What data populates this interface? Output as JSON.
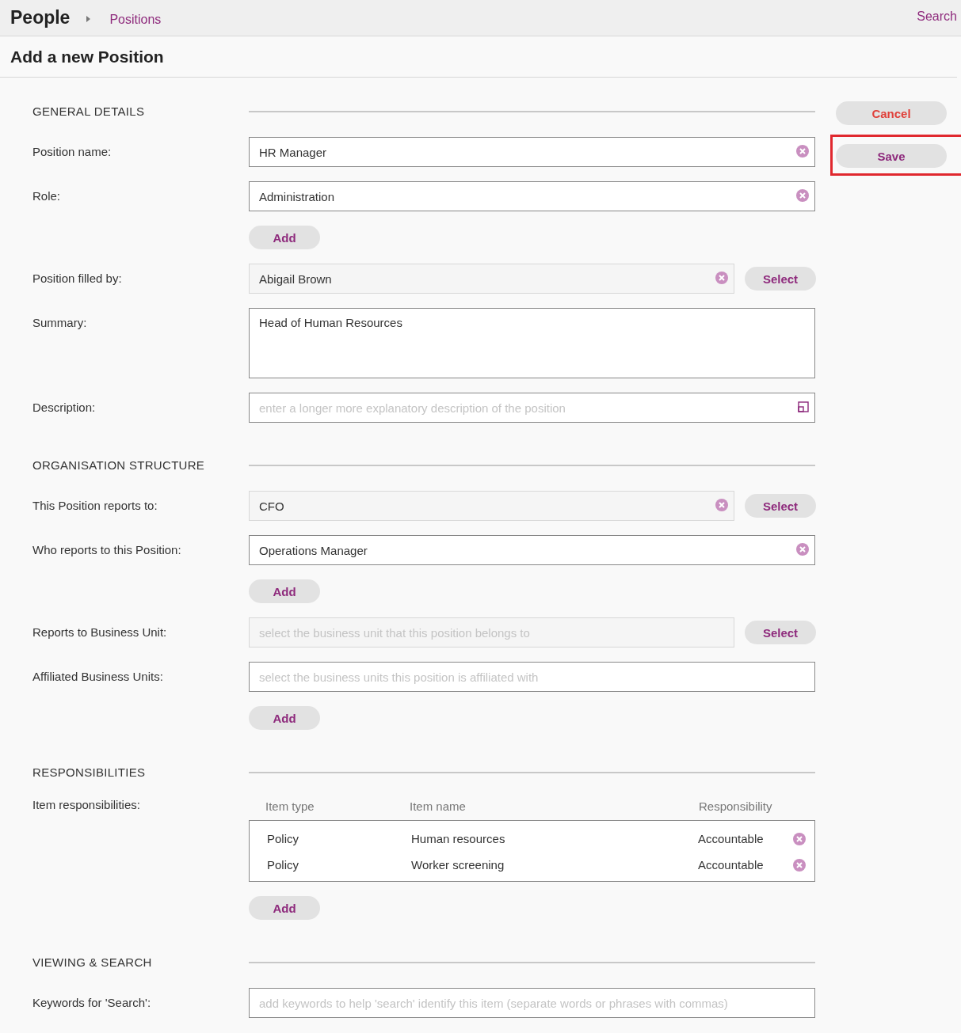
{
  "breadcrumb": {
    "title": "People",
    "current": "Positions"
  },
  "search_link": "Search",
  "page_title": "Add a new Position",
  "actions": [
    {
      "label": "Cancel",
      "kind": "cancel",
      "highlighted": false
    },
    {
      "label": "Save",
      "kind": "save",
      "highlighted": true
    }
  ],
  "sections": [
    {
      "title": "GENERAL DETAILS",
      "rows": [
        {
          "kind": "input",
          "label": "Position name:",
          "value": "HR Manager",
          "clearable": true
        },
        {
          "kind": "input",
          "label": "Role:",
          "value": "Administration",
          "clearable": true
        },
        {
          "kind": "add",
          "button": "Add"
        },
        {
          "kind": "picker",
          "label": "Position filled by:",
          "value": "Abigail Brown",
          "clearable": true,
          "button": "Select"
        },
        {
          "kind": "textarea",
          "label": "Summary:",
          "value": "Head of Human Resources"
        },
        {
          "kind": "input",
          "label": "Description:",
          "placeholder": "enter a longer more explanatory description of the position",
          "expandable": true
        }
      ]
    },
    {
      "title": "ORGANISATION STRUCTURE",
      "rows": [
        {
          "kind": "picker",
          "label": "This Position reports to:",
          "value": "CFO",
          "clearable": true,
          "button": "Select"
        },
        {
          "kind": "input",
          "label": "Who reports to this Position:",
          "value": "Operations Manager",
          "clearable": true
        },
        {
          "kind": "add",
          "button": "Add"
        },
        {
          "kind": "picker",
          "label": "Reports to Business Unit:",
          "placeholder": "select the business unit that this position belongs to",
          "button": "Select"
        },
        {
          "kind": "input",
          "label": "Affiliated Business Units:",
          "placeholder": "select the business units this position is affiliated with"
        },
        {
          "kind": "add",
          "button": "Add"
        }
      ]
    },
    {
      "title": "RESPONSIBILITIES",
      "rows": [
        {
          "kind": "table",
          "label": "Item responsibilities:",
          "columns": [
            "Item type",
            "Item name",
            "Responsibility"
          ],
          "rows": [
            {
              "cells": [
                "Policy",
                "Human resources",
                "Accountable"
              ]
            },
            {
              "cells": [
                "Policy",
                "Worker screening",
                "Accountable"
              ]
            }
          ]
        },
        {
          "kind": "add",
          "button": "Add"
        }
      ]
    },
    {
      "title": "VIEWING & SEARCH",
      "rows": [
        {
          "kind": "input",
          "label": "Keywords for 'Search':",
          "placeholder": "add keywords to help 'search' identify this item (separate words or phrases with commas)"
        }
      ]
    }
  ]
}
